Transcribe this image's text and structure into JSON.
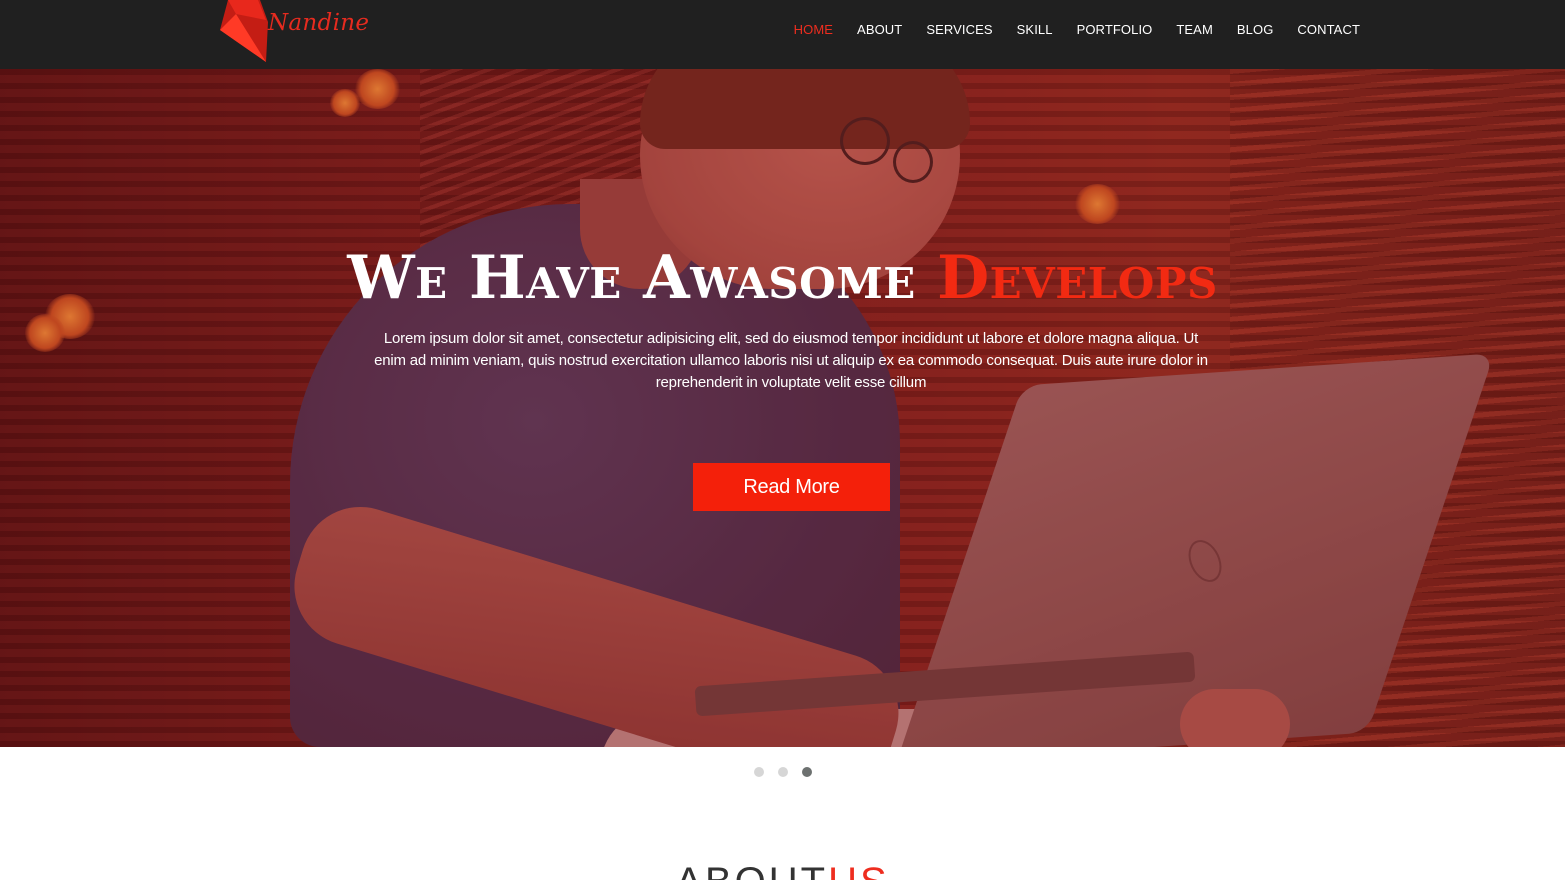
{
  "brand": {
    "name": "Nandine",
    "accent_color": "#ee2d1f"
  },
  "nav": {
    "items": [
      {
        "label": "HOME",
        "active": true
      },
      {
        "label": "ABOUT",
        "active": false
      },
      {
        "label": "SERVICES",
        "active": false
      },
      {
        "label": "SKILL",
        "active": false
      },
      {
        "label": "PORTFOLIO",
        "active": false
      },
      {
        "label": "TEAM",
        "active": false
      },
      {
        "label": "BLOG",
        "active": false
      },
      {
        "label": "CONTACT",
        "active": false
      }
    ]
  },
  "hero": {
    "title_main": "We Have Awasome ",
    "title_accent": "Develops",
    "description": "Lorem ipsum dolor sit amet, consectetur adipisicing elit, sed do eiusmod tempor incididunt ut labore et dolore magna aliqua. Ut enim ad minim veniam, quis nostrud exercitation ullamco laboris nisi ut aliquip ex ea commodo consequat. Duis aute irure dolor in reprehenderit in voluptate velit esse cillum",
    "button_label": "Read More",
    "background_image": "person-with-laptop-photo"
  },
  "slider": {
    "slide_count": 3,
    "active_index": 2
  },
  "next_section": {
    "title_main": "ABOUT ",
    "title_accent": "US"
  }
}
